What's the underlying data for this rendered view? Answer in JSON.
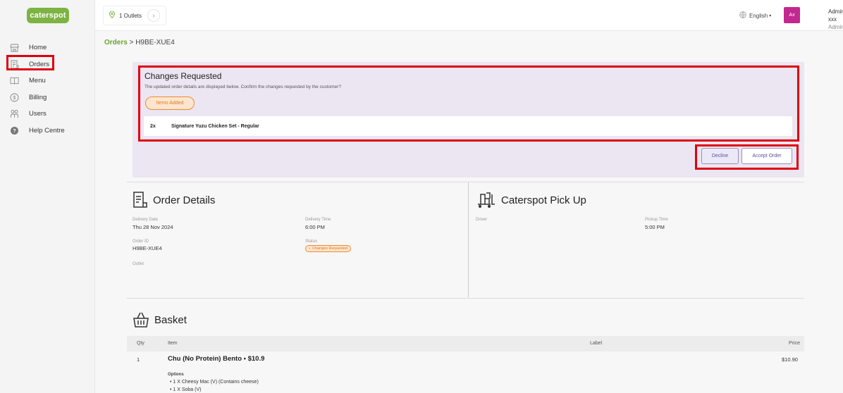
{
  "brand": {
    "logo_text": "caterspot",
    "accent": "#7cb342"
  },
  "sidebar": {
    "items": [
      {
        "label": "Home",
        "icon": "store-icon"
      },
      {
        "label": "Orders",
        "icon": "receipt-icon"
      },
      {
        "label": "Menu",
        "icon": "book-icon"
      },
      {
        "label": "Billing",
        "icon": "dollar-icon"
      },
      {
        "label": "Users",
        "icon": "users-icon"
      },
      {
        "label": "Help Centre",
        "icon": "help-icon"
      }
    ]
  },
  "topbar": {
    "outlets_label": "1 Outlets",
    "language": "English",
    "avatar_initials": "Ax",
    "user_name": "Admin xxx",
    "user_role": "Admin"
  },
  "breadcrumb": {
    "parent": "Orders",
    "separator": ">",
    "current": "H9BE-XUE4"
  },
  "changes": {
    "title": "Changes Requested",
    "subtitle": "The updated order details are displayed below. Confirm the changes requested by the customer?",
    "tag": "Items Added",
    "item_qty": "2x",
    "item_name": "Signature Yuzu Chicken Set - Regular",
    "decline_label": "Decline",
    "accept_label": "Accept Order"
  },
  "order_details": {
    "title": "Order Details",
    "delivery_date_label": "Delivery Date",
    "delivery_date": "Thu 28 Nov 2024",
    "delivery_time_label": "Delivery Time",
    "delivery_time": "6:00 PM",
    "order_id_label": "Order ID",
    "order_id": "H9BE-XUE4",
    "status_label": "Status",
    "status": "Changes Requested",
    "outlet_label": "Outlet"
  },
  "pickup": {
    "title": "Caterspot Pick Up",
    "driver_label": "Driver",
    "pickup_time_label": "Pickup Time",
    "pickup_time": "5:00 PM"
  },
  "basket": {
    "title": "Basket",
    "columns": {
      "qty": "Qty",
      "item": "Item",
      "label": "Label",
      "price": "Price"
    },
    "rows": [
      {
        "qty": "1",
        "item": "Chu (No Protein) Bento • $10.9",
        "price": "$10.90",
        "options_label": "Options",
        "options": [
          "• 1 X Cheesy Mac (V) (Contains cheese)",
          "• 1 X Soba (V)"
        ]
      }
    ]
  }
}
